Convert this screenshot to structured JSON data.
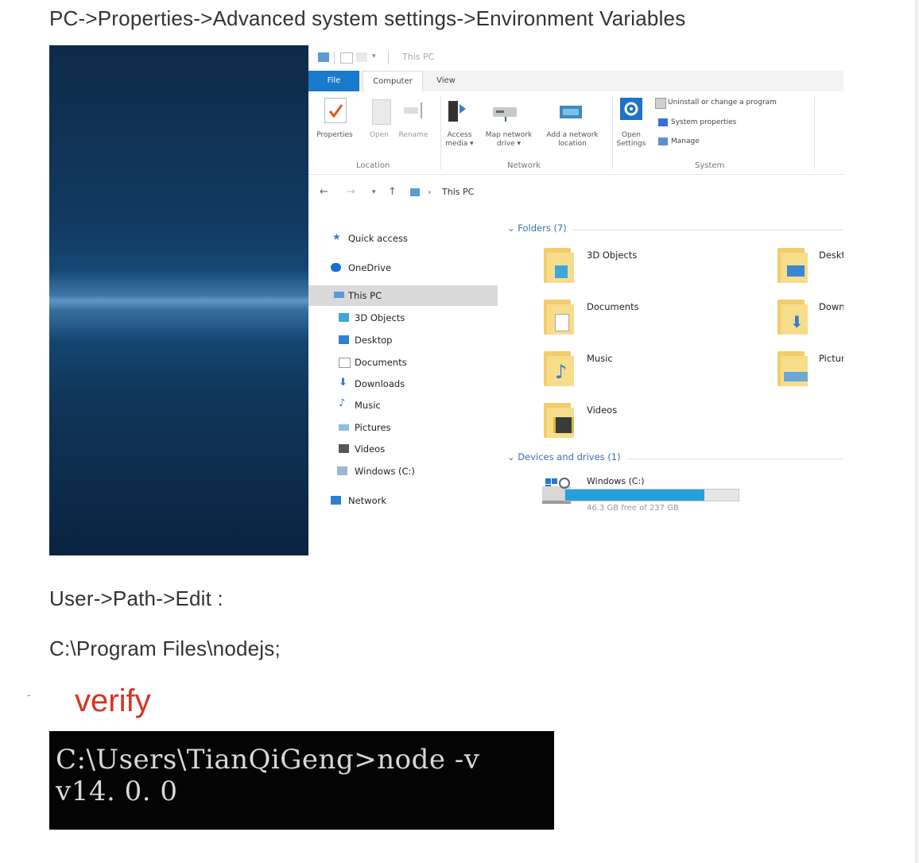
{
  "breadcrumb_text": "PC->Properties->Advanced system settings->Environment Variables",
  "explorer": {
    "window_title": "This PC",
    "tabs": [
      "File",
      "Computer",
      "View"
    ],
    "ribbon": {
      "location_group_label": "Location",
      "network_group_label": "Network",
      "system_group_label": "System",
      "properties": "Properties",
      "open": "Open",
      "rename": "Rename",
      "access_media": "Access media ▾",
      "map_network_drive": "Map network drive ▾",
      "add_network_location": "Add a network location",
      "open_settings": "Open Settings",
      "uninstall": "Uninstall or change a program",
      "system_properties": "System properties",
      "manage": "Manage"
    },
    "address": {
      "path": "This PC"
    },
    "nav": [
      "Quick access",
      "OneDrive",
      "This PC",
      "3D Objects",
      "Desktop",
      "Documents",
      "Downloads",
      "Music",
      "Pictures",
      "Videos",
      "Windows (C:)",
      "Network"
    ],
    "folders_header": "Folders (7)",
    "folders": [
      "3D Objects",
      "Desktop",
      "Documents",
      "Downloa",
      "Music",
      "Pictures",
      "Videos"
    ],
    "devices_header": "Devices and drives (1)",
    "drive": {
      "name": "Windows (C:)",
      "free_text": "46.3 GB free of 237 GB",
      "used_fraction": 0.805
    },
    "colors": {
      "file_tab": "#1979ca",
      "drive_fill": "#26a0da",
      "folder": "#f2cd6a"
    }
  },
  "path_instruction": "User->Path->Edit :",
  "path_value": "C:\\Program Files\\nodejs;",
  "list_marker": "-",
  "verify_heading": "verify",
  "verify_color": "#d9331f",
  "terminal": {
    "command": "C:\\Users\\TianQiGeng>node -v",
    "output": "v14. 0. 0"
  }
}
